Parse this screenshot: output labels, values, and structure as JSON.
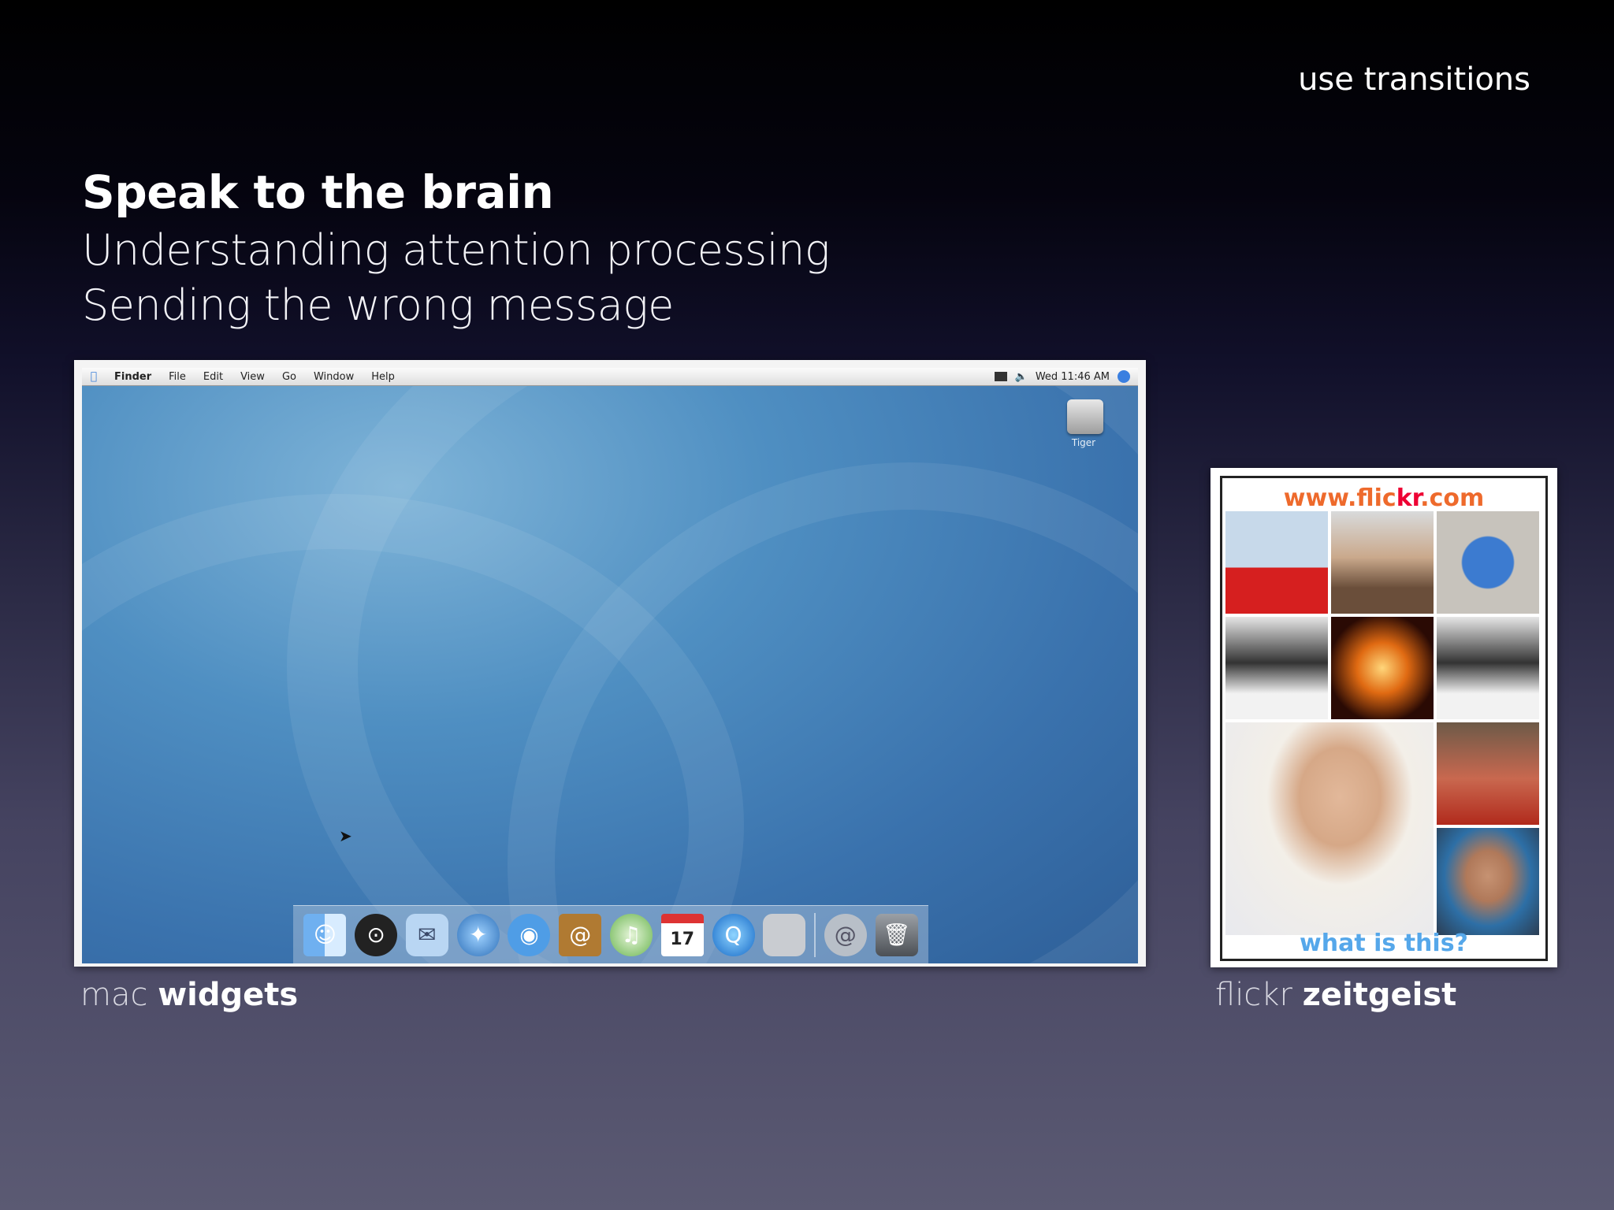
{
  "slide": {
    "corner_label": "use transitions",
    "title": "Speak to the brain",
    "subtitle_lines": [
      "Understanding attention processing",
      "Sending the wrong message"
    ]
  },
  "mac_screenshot": {
    "menu": {
      "apple": "",
      "items": [
        "Finder",
        "File",
        "Edit",
        "View",
        "Go",
        "Window",
        "Help"
      ],
      "clock": "Wed 11:46 AM"
    },
    "desktop_icon_label": "Tiger",
    "dock_icons": [
      "finder-icon",
      "dashboard-icon",
      "mail-icon",
      "safari-icon",
      "ichat-icon",
      "address-book-icon",
      "itunes-icon",
      "ical-icon",
      "quicktime-icon",
      "system-preferences-icon",
      "mail-stamp-icon",
      "trash-icon"
    ],
    "ical_day": "17"
  },
  "flickr_panel": {
    "url_prefix": "www.flic",
    "url_accent": "kr",
    "url_suffix": ".com",
    "footer": "what is this?"
  },
  "captions": {
    "left_light": "mac ",
    "left_bold": "widgets",
    "right_light": "flickr ",
    "right_bold": "zeitgeist"
  }
}
